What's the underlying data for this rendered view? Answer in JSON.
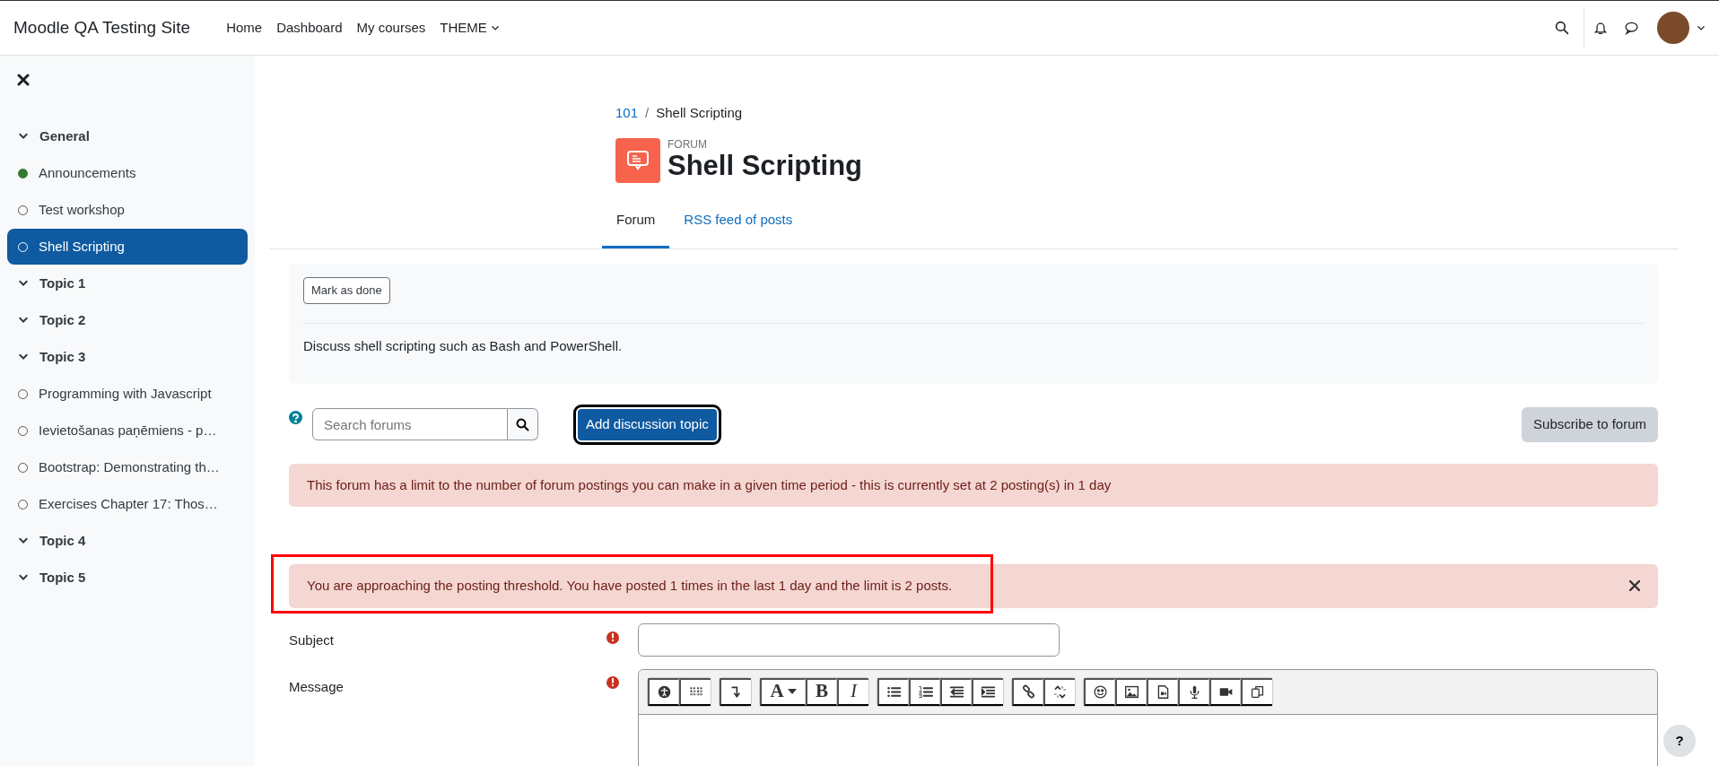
{
  "navbar": {
    "site_name": "Moodle QA Testing Site",
    "links": [
      {
        "label": "Home",
        "dropdown": false
      },
      {
        "label": "Dashboard",
        "dropdown": false
      },
      {
        "label": "My courses",
        "dropdown": false
      },
      {
        "label": "THEME",
        "dropdown": true
      }
    ]
  },
  "sidebar": {
    "items": [
      {
        "kind": "section",
        "label": "General",
        "selected": false
      },
      {
        "kind": "activity",
        "label": "Announcements",
        "completed": true,
        "selected": false
      },
      {
        "kind": "activity",
        "label": "Test workshop",
        "completed": false,
        "selected": false
      },
      {
        "kind": "activity",
        "label": "Shell Scripting",
        "completed": false,
        "selected": true
      },
      {
        "kind": "section",
        "label": "Topic 1",
        "selected": false
      },
      {
        "kind": "section",
        "label": "Topic 2",
        "selected": false
      },
      {
        "kind": "section",
        "label": "Topic 3",
        "selected": false
      },
      {
        "kind": "activity",
        "label": "Programming with Javascript",
        "completed": false,
        "selected": false
      },
      {
        "kind": "activity",
        "label": "Ievietošanas paņēmiens - p…",
        "completed": false,
        "selected": false
      },
      {
        "kind": "activity",
        "label": "Bootstrap: Demonstrating th…",
        "completed": false,
        "selected": false
      },
      {
        "kind": "activity",
        "label": "Exercises Chapter 17: Thos…",
        "completed": false,
        "selected": false
      },
      {
        "kind": "section",
        "label": "Topic 4",
        "selected": false
      },
      {
        "kind": "section",
        "label": "Topic 5",
        "selected": false
      }
    ]
  },
  "breadcrumb": [
    {
      "label": "101",
      "link": true
    },
    {
      "label": "Shell Scripting",
      "link": false
    }
  ],
  "breadcrumb_separator": "/",
  "header": {
    "type_label": "FORUM",
    "title": "Shell Scripting"
  },
  "tabs": [
    {
      "label": "Forum",
      "selected": true
    },
    {
      "label": "RSS feed of posts",
      "selected": false
    }
  ],
  "completion": {
    "button": "Mark as done",
    "description": "Discuss shell scripting such as Bash and PowerShell."
  },
  "search": {
    "placeholder": "Search forums"
  },
  "add_button": "Add discussion topic",
  "subscribe_button": "Subscribe to forum",
  "alerts": [
    {
      "text": "This forum has a limit to the number of forum postings you can make in a given time period - this is currently set at 2 posting(s) in 1 day",
      "dismissible": false,
      "highlighted": false
    },
    {
      "text": "You are approaching the posting threshold. You have posted 1 times in the last 1 day and the limit is 2 posts.",
      "dismissible": true,
      "highlighted": true
    }
  ],
  "form": {
    "fields": [
      {
        "kind": "text",
        "label": "Subject",
        "required": true
      },
      {
        "kind": "editor",
        "label": "Message",
        "required": true
      }
    ]
  },
  "editor_toolbar": [
    [
      {
        "kind": "accessibility"
      },
      {
        "kind": "screenreader"
      }
    ],
    [
      {
        "kind": "undo"
      }
    ],
    [
      {
        "kind": "font",
        "label": "A"
      },
      {
        "kind": "bold",
        "label": "B"
      },
      {
        "kind": "italic",
        "label": "I"
      }
    ],
    [
      {
        "kind": "bullets"
      },
      {
        "kind": "numbers"
      },
      {
        "kind": "outdent"
      },
      {
        "kind": "indent"
      }
    ],
    [
      {
        "kind": "link"
      },
      {
        "kind": "unlink"
      }
    ],
    [
      {
        "kind": "emoji"
      },
      {
        "kind": "image"
      },
      {
        "kind": "media"
      },
      {
        "kind": "microphone"
      },
      {
        "kind": "video"
      },
      {
        "kind": "copy"
      }
    ]
  ],
  "help_button": "?"
}
